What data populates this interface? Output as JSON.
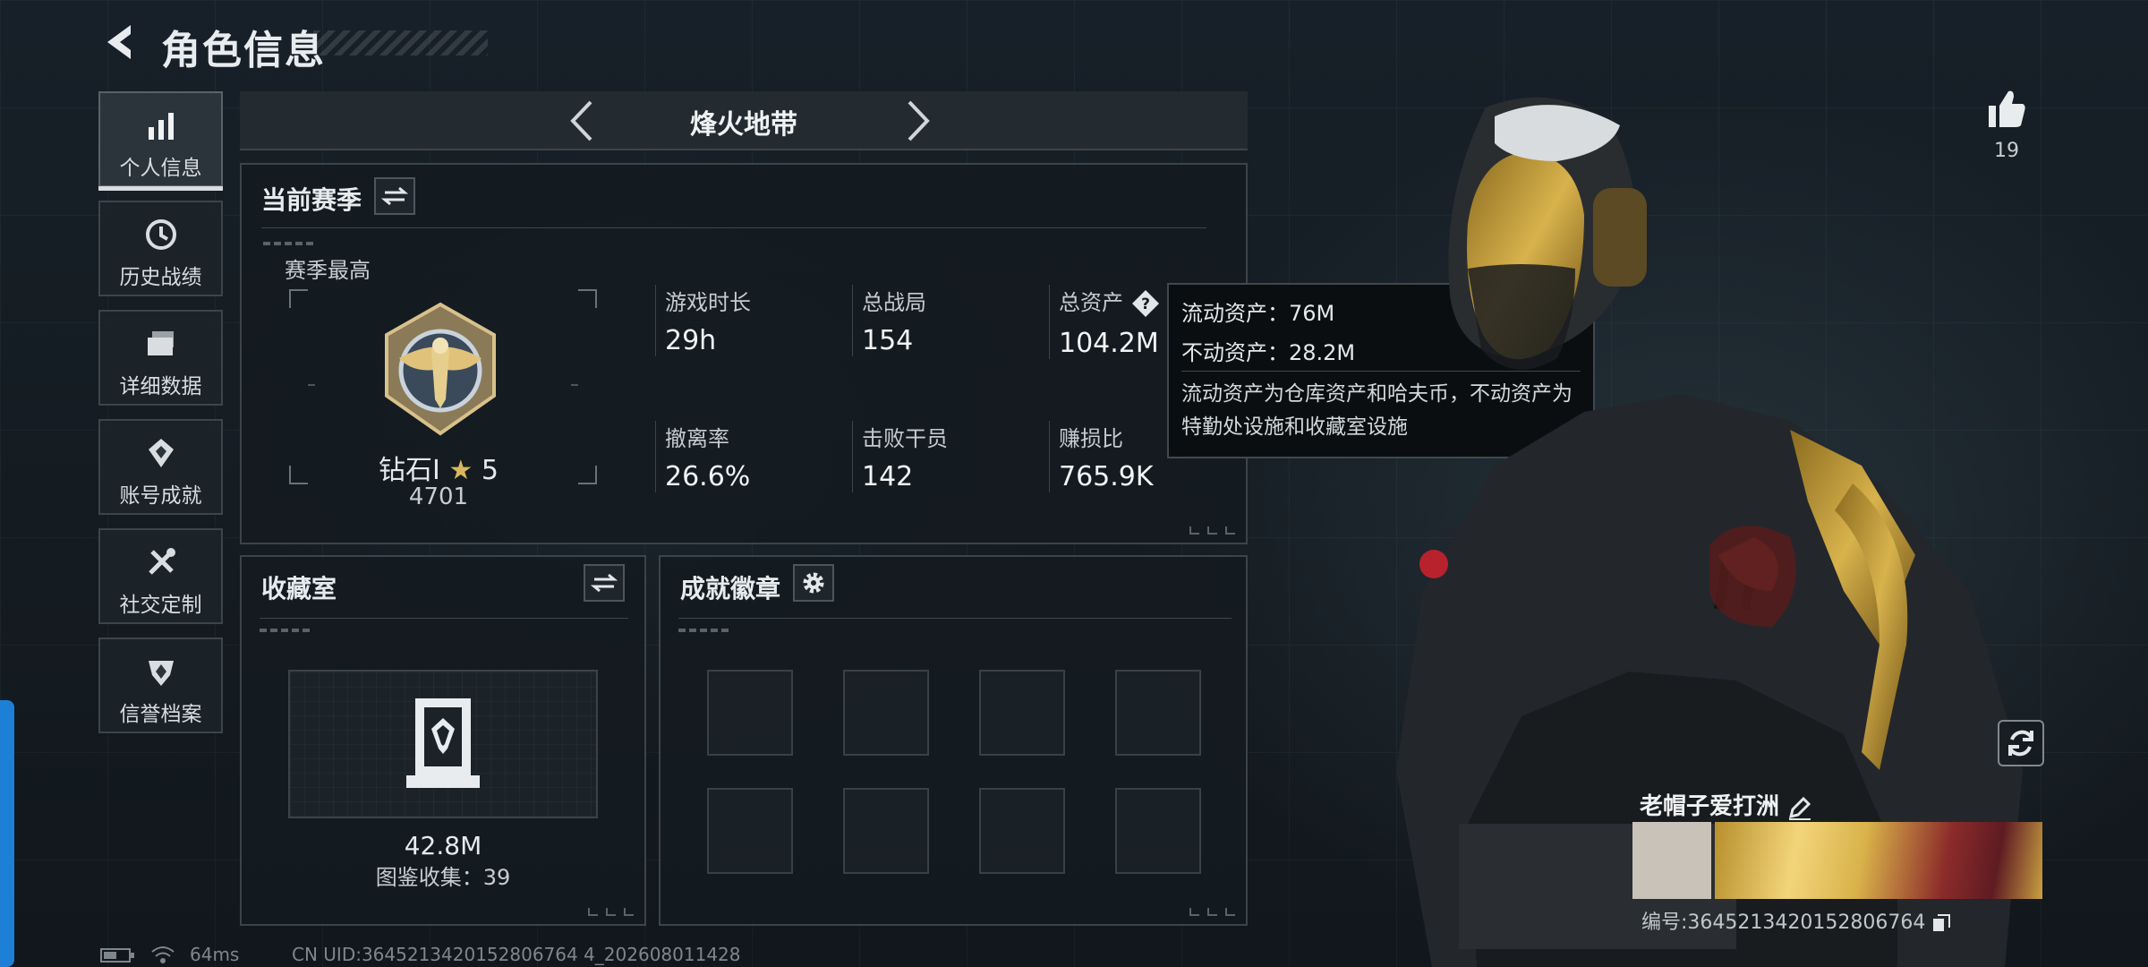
{
  "header": {
    "title": "角色信息"
  },
  "sidebar": {
    "items": [
      {
        "label": "个人信息",
        "icon": "bar-chart-icon",
        "active": true
      },
      {
        "label": "历史战绩",
        "icon": "history-clock-icon"
      },
      {
        "label": "详细数据",
        "icon": "folder-icon"
      },
      {
        "label": "账号成就",
        "icon": "achievement-icon"
      },
      {
        "label": "社交定制",
        "icon": "tools-icon"
      },
      {
        "label": "信誉档案",
        "icon": "credit-shield-icon"
      }
    ]
  },
  "mode": {
    "name": "烽火地带"
  },
  "season": {
    "title": "当前赛季",
    "best_label": "赛季最高",
    "rank": "钻石Ⅰ",
    "stars": "5",
    "score": "4701",
    "stats": [
      {
        "label": "游戏时长",
        "value": "29h"
      },
      {
        "label": "总战局",
        "value": "154"
      },
      {
        "label": "总资产",
        "value": "104.2M"
      },
      {
        "label": "撤离率",
        "value": "26.6%"
      },
      {
        "label": "击败干员",
        "value": "142"
      },
      {
        "label": "赚损比",
        "value": "765.9K"
      }
    ]
  },
  "tooltip": {
    "liquid": "流动资产：76M",
    "fixed": "不动资产：28.2M",
    "desc": "流动资产为仓库资产和哈夫币，不动资产为特勤处设施和收藏室设施"
  },
  "collection": {
    "title": "收藏室",
    "value": "42.8M",
    "count": "图鉴收集：39"
  },
  "achievements": {
    "title": "成就徽章",
    "slots": 8
  },
  "profile": {
    "likes": "19",
    "name": "老帽子爱打洲",
    "uid": "编号:3645213420152806764"
  },
  "status": {
    "ping": "64ms",
    "cn_uid": "CN UID:3645213420152806764 4_202608011428"
  },
  "colors": {
    "accent": "#1d7fd6",
    "panel_border": "#3b444b",
    "background": "#151c22"
  }
}
